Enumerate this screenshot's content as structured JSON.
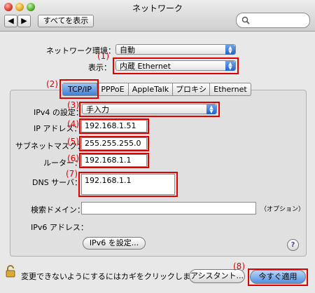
{
  "window": {
    "title": "ネットワーク"
  },
  "toolbar": {
    "show_all": "すべてを表示",
    "back_icon": "back-arrow",
    "forward_icon": "forward-arrow"
  },
  "network": {
    "location_label": "ネットワーク環境：",
    "location_value": "自動",
    "show_label": "表示：",
    "show_value": "内蔵 Ethernet"
  },
  "tabs": [
    {
      "label": "TCP/IP"
    },
    {
      "label": "PPPoE"
    },
    {
      "label": "AppleTalk"
    },
    {
      "label": "プロキシ"
    },
    {
      "label": "Ethernet"
    }
  ],
  "tcpip": {
    "ipv4_label": "IPv4 の設定：",
    "ipv4_value": "手入力",
    "ip_label": "IP アドレス：",
    "ip_value": "192.168.1.51",
    "subnet_label": "サブネットマスク：",
    "subnet_value": "255.255.255.0",
    "router_label": "ルーター：",
    "router_value": "192.168.1.1",
    "dns_label": "DNS サーバ：",
    "dns_value": "192.168.1.1",
    "search_label": "検索ドメイン：",
    "search_value": "",
    "search_hint": "（オプション）",
    "ipv6_label": "IPv6 アドレス：",
    "ipv6_button": "IPv6 を設定...",
    "help": "?"
  },
  "annotations": [
    "(1)",
    "(2)",
    "(3)",
    "(4)",
    "(5)",
    "(6)",
    "(7)",
    "(8)"
  ],
  "footer": {
    "lock_text": "変更できないようにするにはカギをクリックします。",
    "assistant": "アシスタント...",
    "apply": "今すぐ適用"
  }
}
